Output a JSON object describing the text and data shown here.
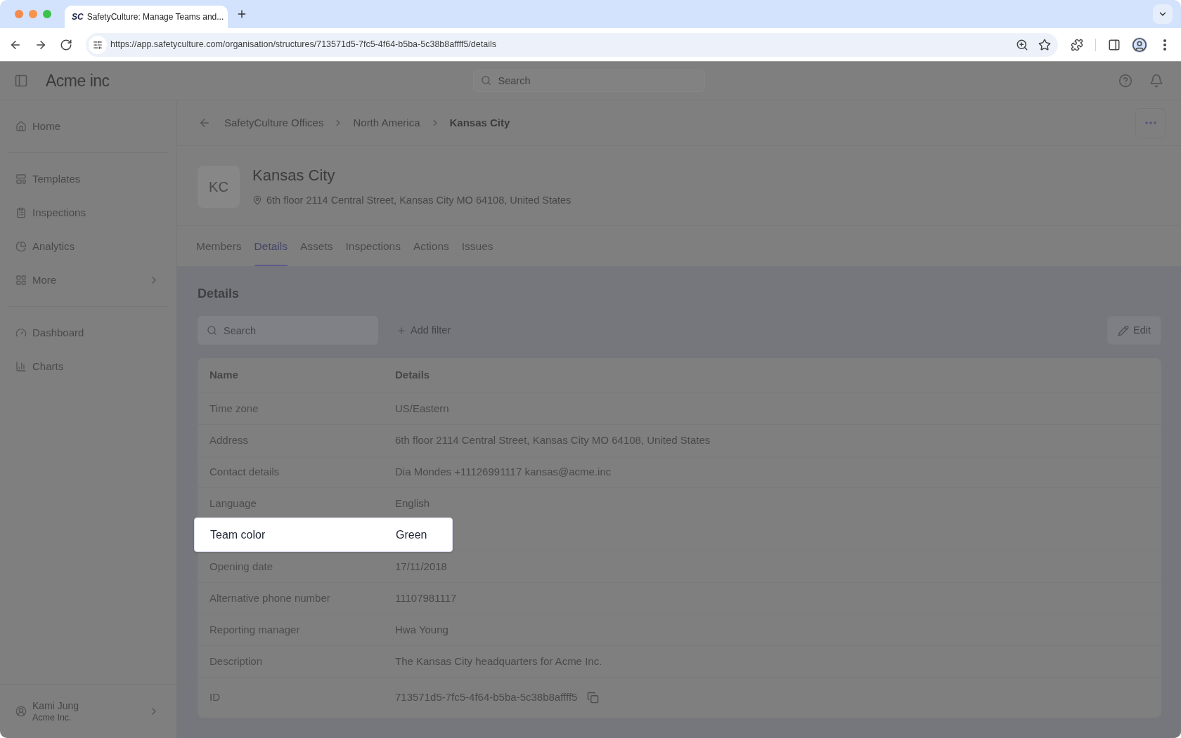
{
  "browser": {
    "tab": {
      "icon_text": "SC",
      "title": "SafetyCulture: Manage Teams and..."
    },
    "url": "https://app.safetyculture.com/organisation/structures/713571d5-7fc5-4f64-b5ba-5c38b8affff5/details"
  },
  "app_header": {
    "logo": "Acme inc",
    "search": {
      "placeholder": "Search"
    }
  },
  "sidebar": {
    "sections": [
      {
        "items": [
          {
            "label": "Home",
            "kind": "link"
          }
        ]
      },
      {
        "items": [
          {
            "label": "Templates",
            "kind": "link"
          },
          {
            "label": "Inspections",
            "kind": "link"
          },
          {
            "label": "Analytics",
            "kind": "link"
          },
          {
            "label": "More",
            "kind": "submenu"
          }
        ]
      },
      {
        "items": [
          {
            "label": "Dashboard",
            "kind": "link"
          },
          {
            "label": "Charts",
            "kind": "link"
          }
        ]
      }
    ],
    "user": {
      "name": "Kami Jung",
      "organisation": "Acme Inc."
    }
  },
  "breadcrumb": [
    {
      "label": "SafetyCulture Offices",
      "current": false
    },
    {
      "label": "North America",
      "current": false
    },
    {
      "label": "Kansas City",
      "current": true
    }
  ],
  "team": {
    "initials": "KC",
    "name": "Kansas City",
    "address": "6th floor 2114 Central Street, Kansas City MO 64108, United States"
  },
  "tabs": [
    {
      "label": "Members",
      "selected": false
    },
    {
      "label": "Details",
      "selected": true
    },
    {
      "label": "Assets",
      "selected": false
    },
    {
      "label": "Inspections",
      "selected": false
    },
    {
      "label": "Actions",
      "selected": false
    },
    {
      "label": "Issues",
      "selected": false
    }
  ],
  "details": {
    "heading": "Details",
    "search": {
      "placeholder": "Search"
    },
    "add_filter": "Add filter",
    "edit": "Edit",
    "table": {
      "columns": [
        "Name",
        "Details"
      ],
      "rows": [
        {
          "name": "Time zone",
          "value": "US/Eastern",
          "kind": "text",
          "highlighted": false
        },
        {
          "name": "Address",
          "value": "6th floor 2114 Central Street, Kansas City MO 64108, United States",
          "kind": "text",
          "highlighted": false
        },
        {
          "name": "Contact details",
          "value": "Dia Mondes +11126991117 kansas@acme.inc",
          "kind": "text",
          "highlighted": false
        },
        {
          "name": "Language",
          "value": "English",
          "kind": "text",
          "highlighted": false
        },
        {
          "name": "Team color",
          "value": "Green",
          "kind": "text",
          "highlighted": true
        },
        {
          "name": "Opening date",
          "value": "17/11/2018",
          "kind": "text",
          "highlighted": false
        },
        {
          "name": "Alternative phone number",
          "value": "11107981117",
          "kind": "text",
          "highlighted": false
        },
        {
          "name": "Reporting manager",
          "value": "Hwa Young",
          "kind": "text",
          "highlighted": false
        },
        {
          "name": "Description",
          "value": "The Kansas City headquarters for Acme Inc.",
          "kind": "text",
          "highlighted": false
        },
        {
          "name": "ID",
          "value": "713571d5-7fc5-4f64-b5ba-5c38b8affff5",
          "kind": "copyable",
          "highlighted": false
        }
      ]
    }
  }
}
